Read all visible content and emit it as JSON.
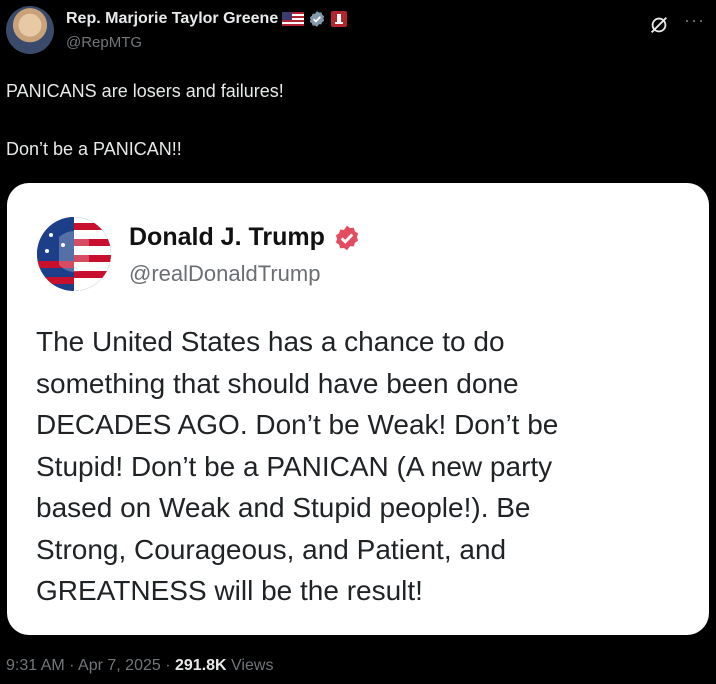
{
  "author": {
    "display_name": "Rep. Marjorie Taylor Greene",
    "handle": "@RepMTG"
  },
  "icons": {
    "flag": "us-flag-icon",
    "verified": "verified-gray-badge-icon",
    "affiliation": "congress-badge-icon",
    "grok": "grok-icon",
    "more": "more-icon"
  },
  "tweet": {
    "line1": "PANICANS are losers and failures!",
    "line2": "Don’t be a PANICAN!!"
  },
  "quoted": {
    "display_name": "Donald J. Trump",
    "handle": "@realDonaldTrump",
    "body_lines": [
      "The United States has a chance to do",
      "something that should have been done",
      "DECADES AGO. Don’t be Weak! Don’t be",
      "Stupid! Don’t be a PANICAN (A new party",
      "based on Weak and Stupid people!). Be",
      "Strong, Courageous, and Patient, and",
      "GREATNESS will be the result!"
    ]
  },
  "meta": {
    "time": "9:31 AM",
    "date": "Apr 7, 2025",
    "separator": " · ",
    "views_count": "291.8K",
    "views_label": "Views"
  },
  "colors": {
    "background": "#000000",
    "verified_blue_gray": "#829aab",
    "truth_badge": "#e44d60",
    "embed_background": "#ffffff"
  }
}
